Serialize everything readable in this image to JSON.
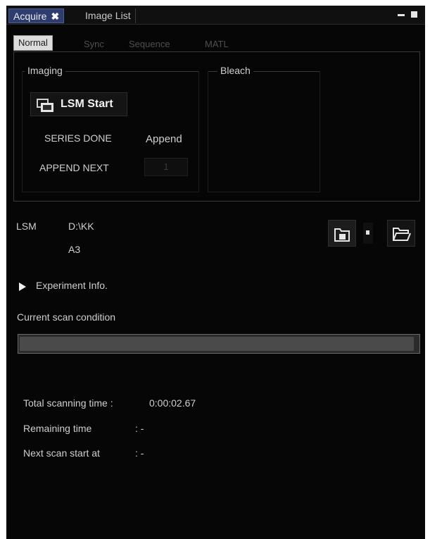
{
  "doc_tabs": [
    {
      "label": "Acquire",
      "close": "✖"
    },
    {
      "label": "Image List"
    }
  ],
  "sub_tabs": [
    "Normal",
    "Sync",
    "Sequence",
    "MATL"
  ],
  "imaging": {
    "title": "Imaging",
    "start_button": "LSM Start",
    "series_label": "SERIES DONE",
    "series_value": "Append",
    "append_label": "APPEND NEXT",
    "append_value": "1"
  },
  "bleach": {
    "title": "Bleach"
  },
  "lsm_path": {
    "label": "LSM",
    "folder": "D:\\KK",
    "name": "A3"
  },
  "experiment_info": "Experiment Info.",
  "scan_condition": {
    "label": "Current scan condition",
    "progress": 0.99
  },
  "timing": {
    "total_label": "Total scanning time :",
    "total_value": "0:00:02.67",
    "remaining_label": "Remaining time",
    "remaining_value": ": -",
    "next_label": "Next scan start at",
    "next_value": ": -"
  },
  "icons": [
    "close-icon",
    "minimize-icon",
    "maximize-icon",
    "lsm-camera-icon",
    "save-folder-icon",
    "dropdown-arrow-icon",
    "open-folder-icon",
    "expand-triangle-icon"
  ],
  "colors": {
    "active_tab": "#2e3d6e",
    "background": "#060606",
    "text": "#d8d8d8"
  }
}
